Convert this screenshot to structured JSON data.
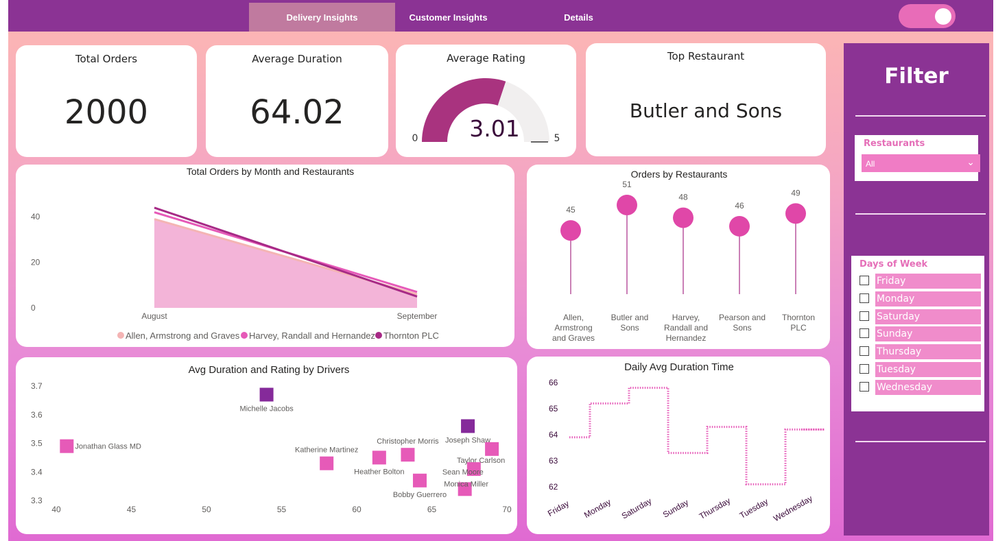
{
  "tabs": [
    {
      "label": "Delivery Insights",
      "active": true
    },
    {
      "label": "Customer Insights",
      "active": false
    },
    {
      "label": "Details",
      "active": false
    }
  ],
  "kpis": {
    "total_orders": {
      "title": "Total Orders",
      "value": "2000"
    },
    "average_duration": {
      "title": "Average Duration",
      "value": "64.02"
    },
    "average_rating": {
      "title": "Average Rating",
      "value": "3.01",
      "min": "0",
      "max": "5",
      "value_num": 3.01,
      "max_num": 5
    },
    "top_restaurant": {
      "title": "Top Restaurant",
      "value": "Butler and Sons"
    }
  },
  "filter": {
    "title": "Filter",
    "restaurants": {
      "label": "Restaurants",
      "selected": "All"
    },
    "days": {
      "label": "Days of Week",
      "items": [
        "Friday",
        "Monday",
        "Saturday",
        "Sunday",
        "Thursday",
        "Tuesday",
        "Wednesday"
      ]
    }
  },
  "colors": {
    "accent": "#8b3394",
    "pink": "#e047a8",
    "gauge": "#a9337f",
    "allen": "#f4b4b4",
    "harvey": "#e65ab8",
    "thornton": "#a72a86"
  },
  "chart_data": [
    {
      "type": "area",
      "title": "Total Orders by Month and Restaurants",
      "categories": [
        "August",
        "September"
      ],
      "yticks": [
        "0",
        "20",
        "40"
      ],
      "ylim": [
        0,
        50
      ],
      "series": [
        {
          "name": "Allen, Armstrong and Graves",
          "values": [
            39,
            6
          ],
          "color": "#f4b4b4"
        },
        {
          "name": "Harvey, Randall and Hernandez",
          "values": [
            42,
            7
          ],
          "color": "#e65ab8"
        },
        {
          "name": "Thornton PLC",
          "values": [
            44,
            5
          ],
          "color": "#a72a86"
        }
      ],
      "legend": "bottom"
    },
    {
      "type": "bar",
      "title": "Orders by Restaurants",
      "categories": [
        [
          "Allen,",
          "Armstrong",
          "and Graves"
        ],
        [
          "Butler and",
          "Sons"
        ],
        [
          "Harvey,",
          "Randall and",
          "Hernandez"
        ],
        [
          "Pearson and",
          "Sons"
        ],
        [
          "Thornton",
          "PLC"
        ]
      ],
      "values": [
        45,
        51,
        48,
        46,
        49
      ],
      "labels": [
        "45",
        "51",
        "48",
        "46",
        "49"
      ],
      "ylim": [
        0,
        55
      ]
    },
    {
      "type": "scatter",
      "title": "Avg Duration and Rating by Drivers",
      "xlim": [
        40,
        70
      ],
      "ylim": [
        3.3,
        3.7
      ],
      "xticks": [
        "40",
        "45",
        "50",
        "55",
        "60",
        "65",
        "70"
      ],
      "yticks": [
        "3.3",
        "3.4",
        "3.5",
        "3.6",
        "3.7"
      ],
      "points": [
        {
          "name": "Jonathan Glass MD",
          "x": 40.7,
          "y": 3.49,
          "highlight": false
        },
        {
          "name": "Michelle Jacobs",
          "x": 54.0,
          "y": 3.67,
          "highlight": true
        },
        {
          "name": "Katherine Martinez",
          "x": 58.0,
          "y": 3.43,
          "highlight": false
        },
        {
          "name": "Heather Bolton",
          "x": 61.5,
          "y": 3.45,
          "highlight": false
        },
        {
          "name": "Christopher Morris",
          "x": 63.4,
          "y": 3.46,
          "highlight": false
        },
        {
          "name": "Bobby Guerrero",
          "x": 64.2,
          "y": 3.37,
          "highlight": false
        },
        {
          "name": "Joseph Shaw",
          "x": 67.4,
          "y": 3.56,
          "highlight": true
        },
        {
          "name": "Taylor Carlson",
          "x": 69.0,
          "y": 3.48,
          "highlight": false
        },
        {
          "name": "Sean Moore",
          "x": 67.8,
          "y": 3.41,
          "highlight": false
        },
        {
          "name": "Monica Miller",
          "x": 67.2,
          "y": 3.34,
          "highlight": false
        }
      ]
    },
    {
      "type": "line",
      "title": "Daily Avg Duration Time",
      "categories": [
        "Friday",
        "Monday",
        "Saturday",
        "Sunday",
        "Thursday",
        "Tuesday",
        "Wednesday"
      ],
      "values": [
        63.9,
        65.2,
        65.8,
        63.3,
        64.3,
        62.1,
        64.2
      ],
      "ylim": [
        62,
        66
      ],
      "yticks": [
        "62",
        "63",
        "64",
        "65",
        "66"
      ],
      "style": "step-dotted"
    }
  ]
}
